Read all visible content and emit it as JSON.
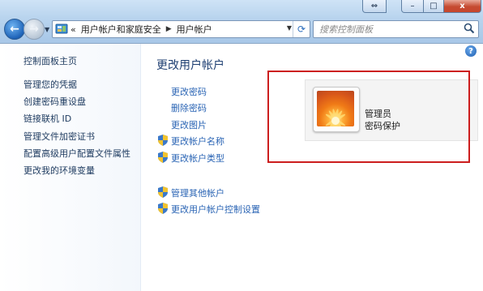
{
  "window": {
    "controls": {
      "resize": "⇔",
      "minimize": "–",
      "maximize": "□",
      "close": "x"
    }
  },
  "nav": {
    "breadcrumb": {
      "overflow": "«",
      "items": [
        "用户帐户和家庭安全",
        "用户帐户"
      ]
    },
    "search_placeholder": "搜索控制面板"
  },
  "sidebar": {
    "items": [
      {
        "label": "控制面板主页"
      },
      {
        "label": "管理您的凭据"
      },
      {
        "label": "创建密码重设盘"
      },
      {
        "label": "链接联机 ID"
      },
      {
        "label": "管理文件加密证书"
      },
      {
        "label": "配置高级用户配置文件属性"
      },
      {
        "label": "更改我的环境变量"
      }
    ]
  },
  "main": {
    "heading": "更改用户帐户",
    "links": [
      {
        "label": "更改密码",
        "shield": false
      },
      {
        "label": "删除密码",
        "shield": false
      },
      {
        "label": "更改图片",
        "shield": false
      },
      {
        "label": "更改帐户名称",
        "shield": true
      },
      {
        "label": "更改帐户类型",
        "shield": true
      }
    ],
    "other_links": [
      {
        "label": "管理其他帐户",
        "shield": true
      },
      {
        "label": "更改用户帐户控制设置",
        "shield": true
      }
    ],
    "user": {
      "name": "管理员",
      "status": "密码保护"
    }
  },
  "colors": {
    "highlight_box": "#cc1e1e",
    "link": "#2a64b4",
    "heading": "#1e3f72"
  },
  "icons": {
    "back": "back-arrow-icon",
    "forward": "forward-arrow-icon",
    "help": "help-icon",
    "shield": "uac-shield-icon",
    "search": "magnifier-icon",
    "refresh": "refresh-icon"
  }
}
